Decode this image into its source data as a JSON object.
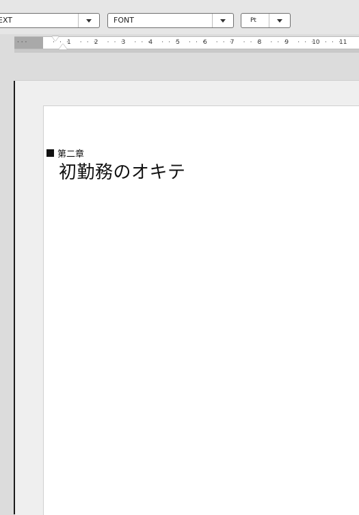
{
  "toolbar": {
    "style_combo": {
      "value": "EXT"
    },
    "font_combo": {
      "value": "FONT"
    },
    "size_combo": {
      "value": "Pt"
    }
  },
  "ruler": {
    "left_marks": "· · ·",
    "marks": [
      "1",
      "2",
      "3",
      "4",
      "5",
      "6",
      "7",
      "8",
      "9",
      "10",
      "11"
    ]
  },
  "document": {
    "chapter_label": "第二章",
    "chapter_title": "初勤務のオキテ"
  },
  "icons": {
    "chapter_bullet": "black-square-icon",
    "dropdown": "triangle-down-icon"
  }
}
